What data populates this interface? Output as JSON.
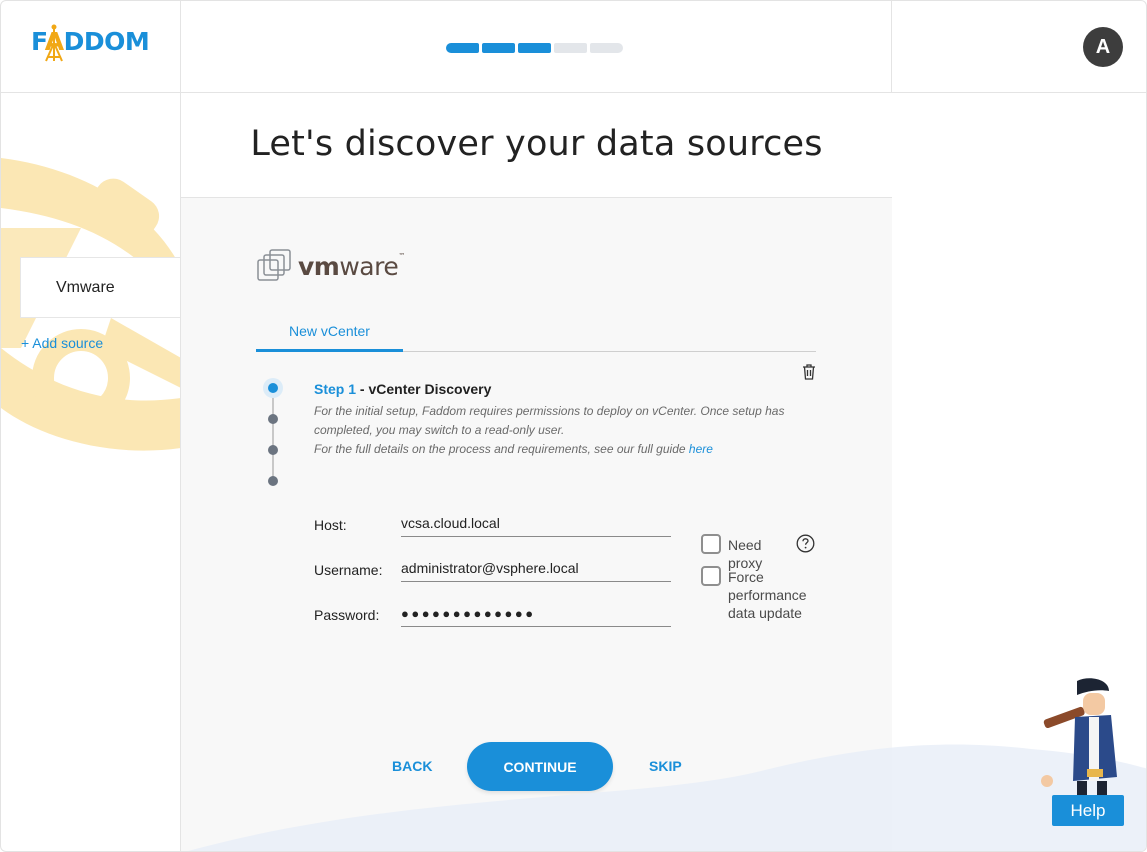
{
  "header": {
    "logo_text_left": "F",
    "logo_text_accent": "A",
    "logo_text_right": "DDOM",
    "progress_steps": [
      {
        "state": "done"
      },
      {
        "state": "done"
      },
      {
        "state": "done"
      },
      {
        "state": "todo"
      },
      {
        "state": "todo"
      }
    ],
    "avatar_initial": "A"
  },
  "sidebar": {
    "sources": [
      {
        "label": "Vmware"
      }
    ],
    "add_source_label": "+ Add source"
  },
  "page": {
    "title": "Let's discover your data sources"
  },
  "main": {
    "vendor_logo_text": "vm",
    "vendor_logo_text2": "ware",
    "vendor_logo_tm": "™",
    "tabs": [
      {
        "label": "New vCenter",
        "active": true
      }
    ],
    "step": {
      "number": "Step 1",
      "separator": " - ",
      "name": "vCenter Discovery",
      "desc_line1": "For the initial setup, Faddom requires permissions to deploy on vCenter. Once setup has completed, you may switch to a read-only user.",
      "desc_line2": "For the full details on the process and requirements, see our full guide ",
      "desc_link": "here"
    },
    "form": {
      "host_label": "Host:",
      "host_value": "vcsa.cloud.local",
      "username_label": "Username:",
      "username_value": "administrator@vsphere.local",
      "password_label": "Password:",
      "password_value": "●●●●●●●●●●●●●"
    },
    "options": {
      "need_proxy_label": "Need proxy",
      "need_proxy_checked": false,
      "force_perf_label": "Force performance data update",
      "force_perf_checked": false
    },
    "buttons": {
      "back": "BACK",
      "continue": "CONTINUE",
      "skip": "SKIP"
    }
  },
  "help": {
    "label": "Help"
  },
  "colors": {
    "accent": "#1a8fd9",
    "brand_orange": "#f1a816",
    "avatar_bg": "#3d3d3d"
  },
  "icons": [
    "faddom-logo-icon",
    "trash-icon",
    "question-icon",
    "vmware-logo-icon",
    "pirate-help-icon"
  ]
}
